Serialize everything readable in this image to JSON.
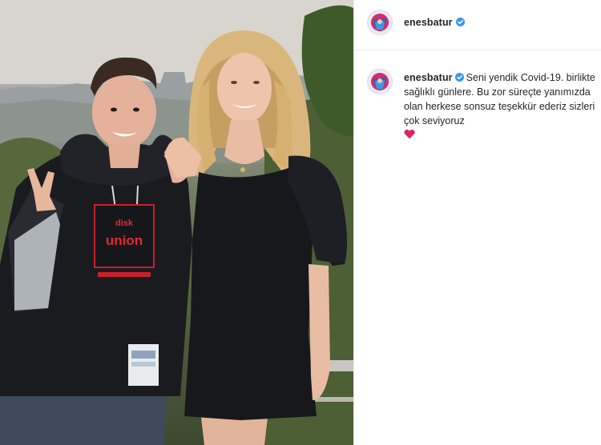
{
  "post": {
    "author": {
      "username": "enesbatur",
      "verified": true,
      "avatar_icon": "profile-avatar-icon"
    },
    "caption": {
      "username": "enesbatur",
      "text": "Seni yendik Covid-19. birlikte sağlıklı günlere. Bu zor süreçte yanımızda olan herkese sonsuz teşekkür ederiz sizleri çok seviyoruz",
      "emoji": "red-heart-icon"
    },
    "photo": {
      "sweatshirt_text_top": "disk",
      "sweatshirt_text_main": "union"
    }
  },
  "colors": {
    "verified_badge": "#3897f0",
    "heart": "#e0245e",
    "divider": "#efefef",
    "text": "#262626"
  }
}
